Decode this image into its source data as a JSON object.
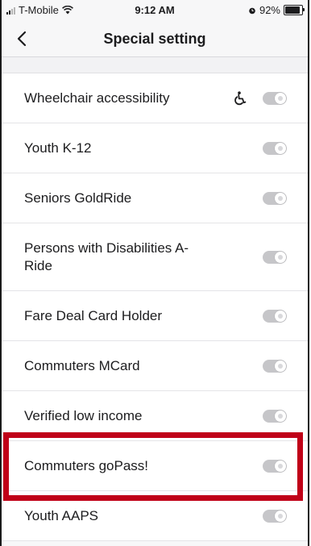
{
  "status_bar": {
    "carrier": "T-Mobile",
    "time": "9:12 AM",
    "battery_text": "92%",
    "battery_level": 0.92
  },
  "nav": {
    "back_icon": "chevron-left-icon",
    "title": "Special setting"
  },
  "settings": [
    {
      "label": "Wheelchair accessibility",
      "enabled": false,
      "icon": "wheelchair-icon"
    },
    {
      "label": "Youth K-12",
      "enabled": false
    },
    {
      "label": "Seniors GoldRide",
      "enabled": false
    },
    {
      "label": "Persons with Disabilities A-Ride",
      "enabled": false
    },
    {
      "label": "Fare Deal Card Holder",
      "enabled": false
    },
    {
      "label": "Commuters MCard",
      "enabled": false
    },
    {
      "label": "Verified low income",
      "enabled": false
    },
    {
      "label": "Commuters goPass!",
      "enabled": false,
      "highlighted": true
    },
    {
      "label": "Youth AAPS",
      "enabled": false
    }
  ],
  "colors": {
    "highlight": "#c00018",
    "toggle_off": "#c6c6c9"
  }
}
